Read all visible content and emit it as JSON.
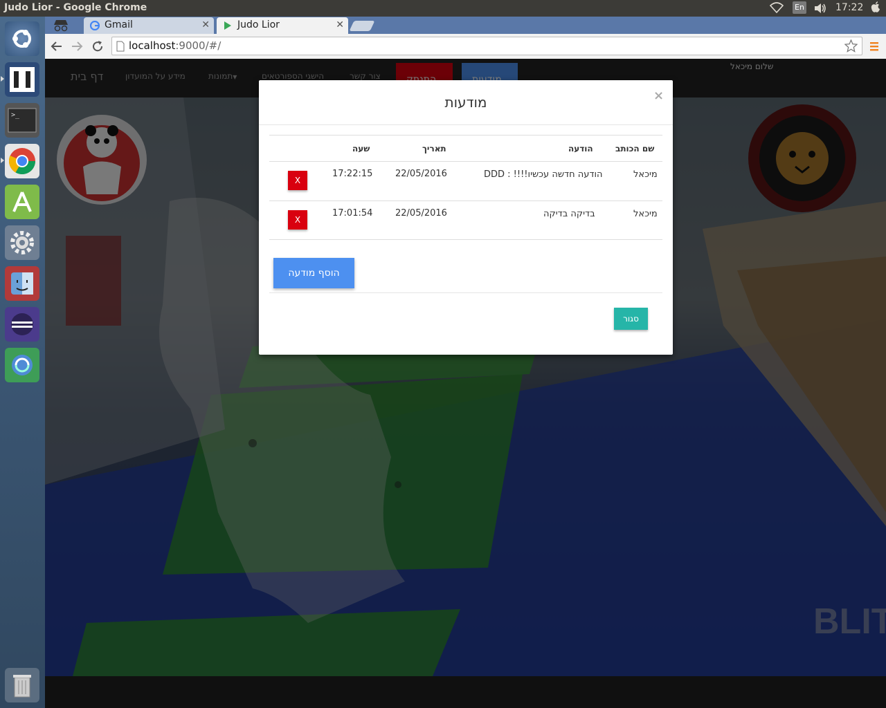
{
  "os": {
    "window_title": "Judo Lior - Google Chrome",
    "lang_indicator": "En",
    "clock": "17:22"
  },
  "launcher": {
    "items": [
      {
        "name": "ubuntu-dash-icon"
      },
      {
        "name": "brackets-icon"
      },
      {
        "name": "terminal-icon"
      },
      {
        "name": "chrome-icon"
      },
      {
        "name": "android-studio-icon"
      },
      {
        "name": "system-settings-icon"
      },
      {
        "name": "finder-icon"
      },
      {
        "name": "eclipse-icon"
      },
      {
        "name": "software-updater-icon"
      }
    ],
    "trash": {
      "name": "trash-icon"
    }
  },
  "browser": {
    "tabs": [
      {
        "label": "Gmail",
        "active": false
      },
      {
        "label": "Judo Lior",
        "active": true
      }
    ],
    "url_host": "localhost",
    "url_path": ":9000/#/"
  },
  "site": {
    "nav": {
      "home": "דף בית",
      "club_info": "מידע על המועדון",
      "photos": "תמונות",
      "achievements": "הישגי הספורטאים",
      "contact": "צור קשר",
      "disconnect": "התנתק",
      "messages": "מודעות"
    },
    "greeting": "שלום מיכאל",
    "watermark": "BLIT"
  },
  "modal": {
    "title": "מודעות",
    "close_symbol": "×",
    "columns": {
      "author": "שם הכותב",
      "message": "הודעה",
      "date": "תאריך",
      "time": "שעה"
    },
    "rows": [
      {
        "author": "מיכאל",
        "message": "הודעה חדשה עכשיו!!!! : DDD",
        "date": "22/05/2016",
        "time": "17:22:15",
        "delete": "X"
      },
      {
        "author": "מיכאל",
        "message": "בדיקה בדיקה",
        "date": "22/05/2016",
        "time": "17:01:54",
        "delete": "X"
      }
    ],
    "add_button": "הוסף מודעה",
    "close_button": "סגור"
  },
  "colors": {
    "delete_red": "#d9000f",
    "add_blue": "#4d90f0",
    "close_teal": "#26b5a8",
    "nav_dark": "#232323"
  }
}
